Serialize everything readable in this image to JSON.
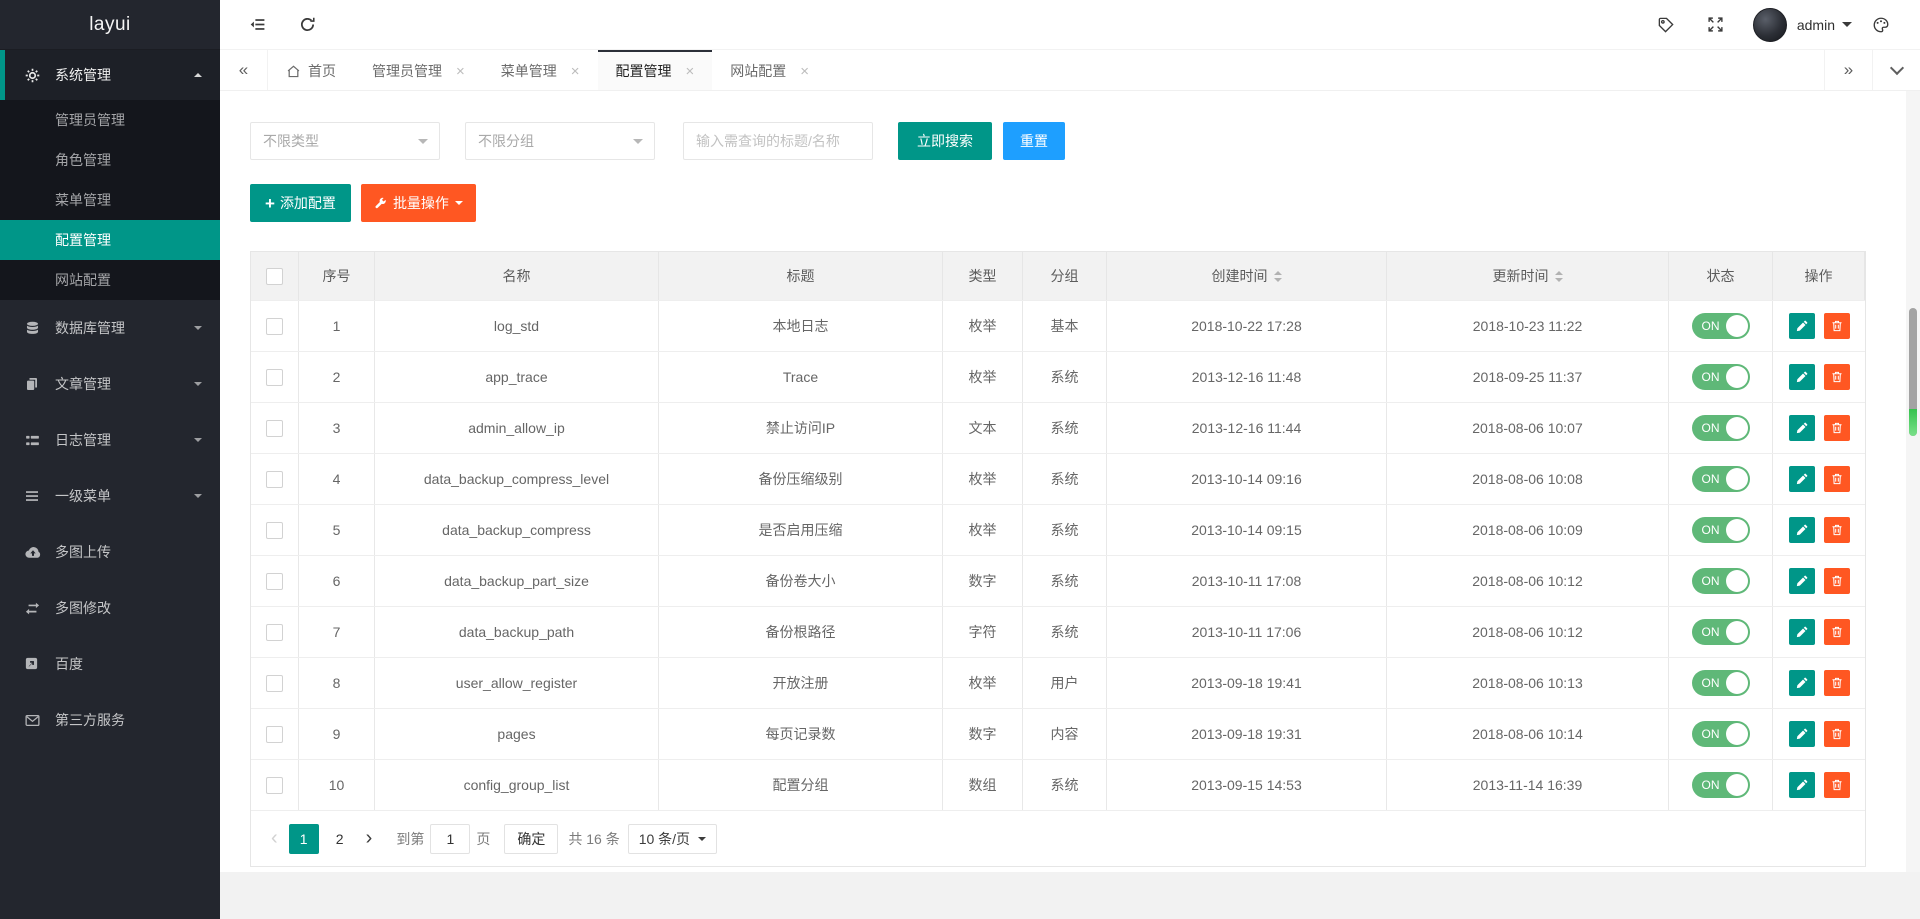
{
  "app": {
    "logo": "layui"
  },
  "colors": {
    "accent": "#009688",
    "blue": "#1E9FFF",
    "orange": "#FF5722",
    "toggle_green": "#5FB878"
  },
  "sidebar": {
    "items": [
      {
        "label": "系统管理",
        "icon": "gear-icon",
        "expanded": true,
        "children": [
          {
            "label": "管理员管理",
            "active": false
          },
          {
            "label": "角色管理",
            "active": false
          },
          {
            "label": "菜单管理",
            "active": false
          },
          {
            "label": "配置管理",
            "active": true
          },
          {
            "label": "网站配置",
            "active": false
          }
        ]
      },
      {
        "label": "数据库管理",
        "icon": "database-icon",
        "caret": "down"
      },
      {
        "label": "文章管理",
        "icon": "copy-icon",
        "caret": "down"
      },
      {
        "label": "日志管理",
        "icon": "log-icon",
        "caret": "down"
      },
      {
        "label": "一级菜单",
        "icon": "menu-icon",
        "caret": "down"
      },
      {
        "label": "多图上传",
        "icon": "cloud-upload-icon"
      },
      {
        "label": "多图修改",
        "icon": "exchange-icon"
      },
      {
        "label": "百度",
        "icon": "external-link-icon"
      },
      {
        "label": "第三方服务",
        "icon": "envelope-icon"
      }
    ]
  },
  "header": {
    "username": "admin"
  },
  "tabbar": {
    "tabs": [
      {
        "label": "首页",
        "home": true,
        "closable": false,
        "active": false
      },
      {
        "label": "管理员管理",
        "closable": true,
        "active": false
      },
      {
        "label": "菜单管理",
        "closable": true,
        "active": false
      },
      {
        "label": "配置管理",
        "closable": true,
        "active": true
      },
      {
        "label": "网站配置",
        "closable": true,
        "active": false
      }
    ]
  },
  "filters": {
    "type_placeholder": "不限类型",
    "group_placeholder": "不限分组",
    "search_placeholder": "输入需查询的标题/名称",
    "search_button": "立即搜索",
    "reset_button": "重置",
    "add_button": "添加配置",
    "batch_button": "批量操作"
  },
  "table": {
    "headers": [
      "序号",
      "名称",
      "标题",
      "类型",
      "分组",
      "创建时间",
      "更新时间",
      "状态",
      "操作"
    ],
    "rows": [
      {
        "no": "1",
        "name": "log_std",
        "title": "本地日志",
        "type": "枚举",
        "group": "基本",
        "created": "2018-10-22 17:28",
        "updated": "2018-10-23 11:22",
        "status": "ON"
      },
      {
        "no": "2",
        "name": "app_trace",
        "title": "Trace",
        "type": "枚举",
        "group": "系统",
        "created": "2013-12-16 11:48",
        "updated": "2018-09-25 11:37",
        "status": "ON"
      },
      {
        "no": "3",
        "name": "admin_allow_ip",
        "title": "禁止访问IP",
        "type": "文本",
        "group": "系统",
        "created": "2013-12-16 11:44",
        "updated": "2018-08-06 10:07",
        "status": "ON"
      },
      {
        "no": "4",
        "name": "data_backup_compress_level",
        "title": "备份压缩级别",
        "type": "枚举",
        "group": "系统",
        "created": "2013-10-14 09:16",
        "updated": "2018-08-06 10:08",
        "status": "ON"
      },
      {
        "no": "5",
        "name": "data_backup_compress",
        "title": "是否启用压缩",
        "type": "枚举",
        "group": "系统",
        "created": "2013-10-14 09:15",
        "updated": "2018-08-06 10:09",
        "status": "ON"
      },
      {
        "no": "6",
        "name": "data_backup_part_size",
        "title": "备份卷大小",
        "type": "数字",
        "group": "系统",
        "created": "2013-10-11 17:08",
        "updated": "2018-08-06 10:12",
        "status": "ON"
      },
      {
        "no": "7",
        "name": "data_backup_path",
        "title": "备份根路径",
        "type": "字符",
        "group": "系统",
        "created": "2013-10-11 17:06",
        "updated": "2018-08-06 10:12",
        "status": "ON"
      },
      {
        "no": "8",
        "name": "user_allow_register",
        "title": "开放注册",
        "type": "枚举",
        "group": "用户",
        "created": "2013-09-18 19:41",
        "updated": "2018-08-06 10:13",
        "status": "ON"
      },
      {
        "no": "9",
        "name": "pages",
        "title": "每页记录数",
        "type": "数字",
        "group": "内容",
        "created": "2013-09-18 19:31",
        "updated": "2018-08-06 10:14",
        "status": "ON"
      },
      {
        "no": "10",
        "name": "config_group_list",
        "title": "配置分组",
        "type": "数组",
        "group": "系统",
        "created": "2013-09-15 14:53",
        "updated": "2013-11-14 16:39",
        "status": "ON"
      }
    ]
  },
  "pagination": {
    "pages": [
      "1",
      "2"
    ],
    "current": "1",
    "jump_label": "到第",
    "jump_value": "1",
    "page_label": "页",
    "confirm_button": "确定",
    "total_label": "共 16 条",
    "page_size": "10 条/页"
  }
}
